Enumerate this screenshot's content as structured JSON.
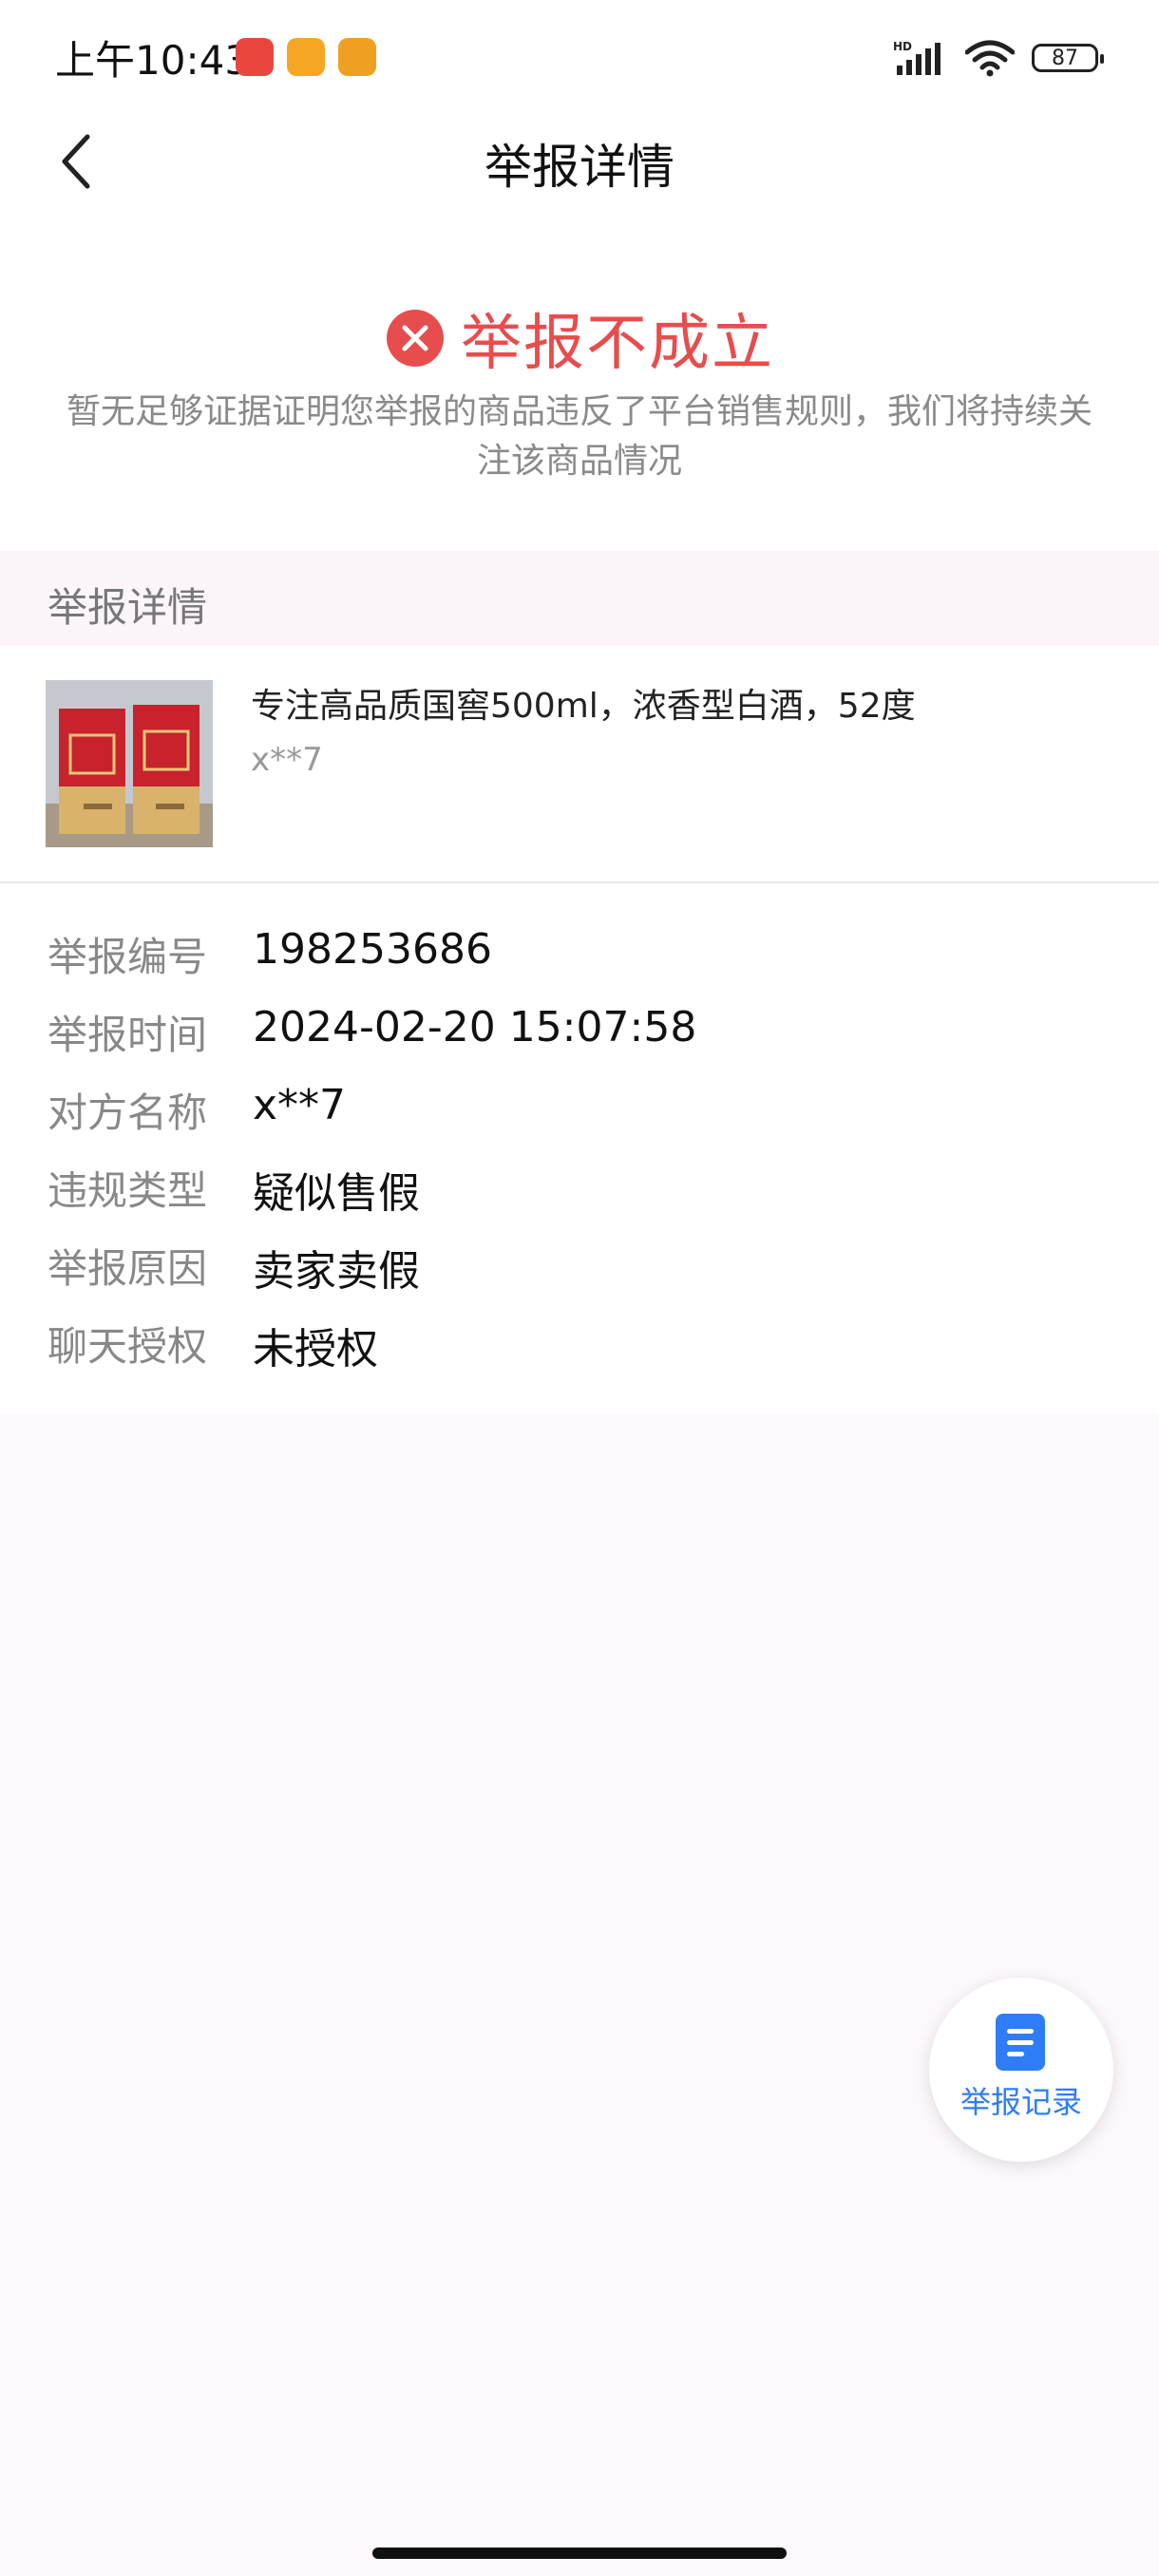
{
  "status_bar": {
    "time": "上午10:43",
    "network": "HD",
    "battery": "87"
  },
  "nav": {
    "title": "举报详情"
  },
  "result": {
    "title": "举报不成立",
    "description": "暂无足够证据证明您举报的商品违反了平台销售规则，我们将持续关注该商品情况",
    "status_color": "#e74d4d"
  },
  "section": {
    "title": "举报详情"
  },
  "product": {
    "title": "专注高品质国窖500ml，浓香型白酒，52度",
    "seller": "x**7"
  },
  "details": [
    {
      "label": "举报编号",
      "value": "198253686"
    },
    {
      "label": "举报时间",
      "value": "2024-02-20 15:07:58"
    },
    {
      "label": "对方名称",
      "value": "x**7"
    },
    {
      "label": "违规类型",
      "value": "疑似售假"
    },
    {
      "label": "举报原因",
      "value": "卖家卖假"
    },
    {
      "label": "聊天授权",
      "value": "未授权"
    }
  ],
  "fab": {
    "label": "举报记录",
    "accent": "#2f7df6"
  }
}
